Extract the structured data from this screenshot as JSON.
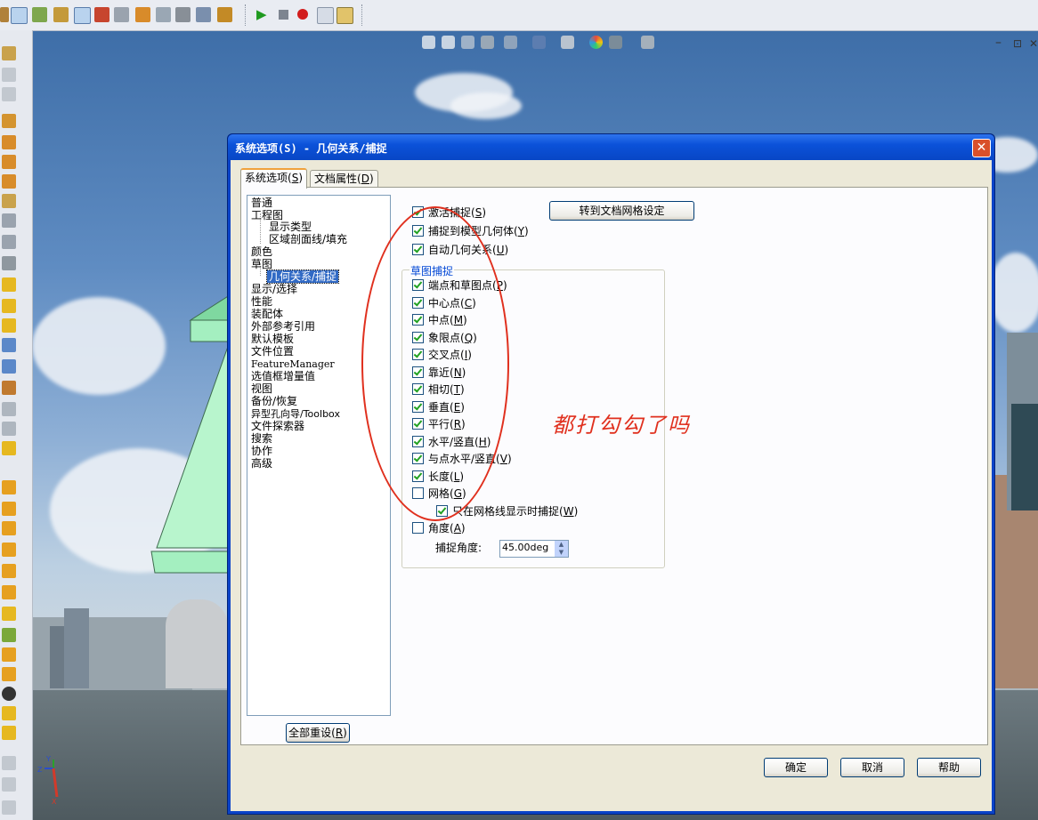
{
  "dialog": {
    "title": "系统选项(S) - 几何关系/捕捉",
    "close_label": "✕",
    "tabs": [
      {
        "label": "系统选项(",
        "key": "S",
        "suffix": ")"
      },
      {
        "label": "文档属性(",
        "key": "D",
        "suffix": ")"
      }
    ],
    "tree_items": [
      {
        "label": "普通"
      },
      {
        "label": "工程图"
      },
      {
        "label": "显示类型"
      },
      {
        "label": "区域剖面线/填充"
      },
      {
        "label": "颜色"
      },
      {
        "label": "草图"
      },
      {
        "label": "几何关系/捕捉"
      },
      {
        "label": "显示/选择"
      },
      {
        "label": "性能"
      },
      {
        "label": "装配体"
      },
      {
        "label": "外部参考引用"
      },
      {
        "label": "默认模板"
      },
      {
        "label": "文件位置"
      },
      {
        "label": "FeatureManager"
      },
      {
        "label": "选值框增量值"
      },
      {
        "label": "视图"
      },
      {
        "label": "备份/恢复"
      },
      {
        "label": "异型孔向导/Toolbox"
      },
      {
        "label": "文件探索器"
      },
      {
        "label": "搜索"
      },
      {
        "label": "协作"
      },
      {
        "label": "高级"
      }
    ],
    "reset_all_button": {
      "label": "全部重设(",
      "key": "R",
      "suffix": ")"
    },
    "goto_grid_button": "转到文档网格设定",
    "top_options": [
      {
        "label": "激活捕捉(",
        "key": "S",
        "suffix": ")",
        "checked": true
      },
      {
        "label": "捕捉到模型几何体(",
        "key": "Y",
        "suffix": ")",
        "checked": true
      },
      {
        "label": "自动几何关系(",
        "key": "U",
        "suffix": ")",
        "checked": true
      }
    ],
    "snap_group_label": "草图捕捉",
    "snap_options": [
      {
        "label": "端点和草图点(",
        "key": "P",
        "suffix": ")",
        "checked": true
      },
      {
        "label": "中心点(",
        "key": "C",
        "suffix": ")",
        "checked": true
      },
      {
        "label": "中点(",
        "key": "M",
        "suffix": ")",
        "checked": true
      },
      {
        "label": "象限点(",
        "key": "Q",
        "suffix": ")",
        "checked": true
      },
      {
        "label": "交叉点(",
        "key": "I",
        "suffix": ")",
        "checked": true
      },
      {
        "label": "靠近(",
        "key": "N",
        "suffix": ")",
        "checked": true
      },
      {
        "label": "相切(",
        "key": "T",
        "suffix": ")",
        "checked": true
      },
      {
        "label": "垂直(",
        "key": "E",
        "suffix": ")",
        "checked": true
      },
      {
        "label": "平行(",
        "key": "R",
        "suffix": ")",
        "checked": true
      },
      {
        "label": "水平/竖直(",
        "key": "H",
        "suffix": ")",
        "checked": true
      },
      {
        "label": "与点水平/竖直(",
        "key": "V",
        "suffix": ")",
        "checked": true
      },
      {
        "label": "长度(",
        "key": "L",
        "suffix": ")",
        "checked": true
      },
      {
        "label": "网格(",
        "key": "G",
        "suffix": ")",
        "checked": false
      }
    ],
    "grid_sub_option": {
      "label": "只在网格线显示时捕捉(",
      "key": "W",
      "suffix": ")",
      "checked": true
    },
    "angle_option": {
      "label": "角度(",
      "key": "A",
      "suffix": ")",
      "checked": false
    },
    "snap_angle_label": "捕捉角度:",
    "snap_angle_value": "45.00deg",
    "ok_button": "确定",
    "cancel_button": "取消",
    "help_button": "帮助"
  },
  "annotation_text": "都打勾勾了吗",
  "axes": {
    "x": "X",
    "y": "Y",
    "z": "Z"
  },
  "window_controls": [
    "–",
    "⊡",
    "✕"
  ],
  "colors": {
    "title_bar": "#0b52d9",
    "dialog_face": "#ece9d8",
    "annotation_red": "#e0301e",
    "check_green": "#21a121",
    "group_label_blue": "#0046d5",
    "selection_blue": "#316ac5"
  }
}
